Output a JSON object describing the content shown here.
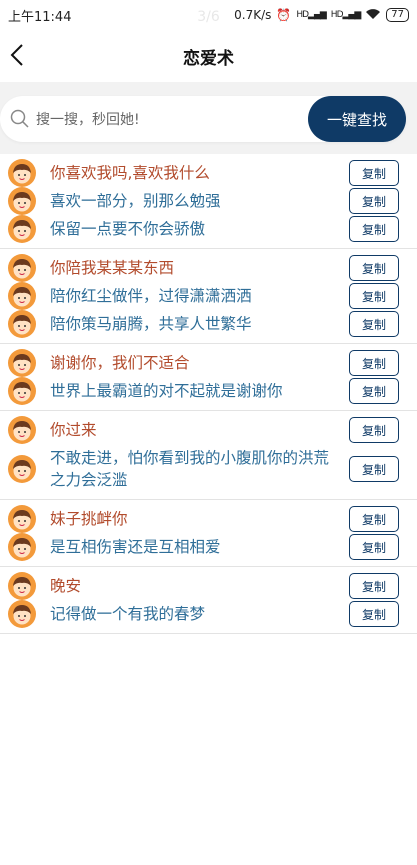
{
  "status_bar": {
    "time": "上午11:44",
    "network_speed": "0.7K/s",
    "signal_1": "HD",
    "signal_2": "HD",
    "battery": "77",
    "page_indicator": "3/6"
  },
  "nav": {
    "title": "恋爱术"
  },
  "search": {
    "placeholder": "搜一搜，秒回她!",
    "button_label": "一键查找"
  },
  "copy_label": "复制",
  "groups": [
    {
      "lines": [
        {
          "role": "lead",
          "text": "你喜欢我吗,喜欢我什么"
        },
        {
          "role": "reply",
          "text": "喜欢一部分，别那么勉强"
        },
        {
          "role": "reply",
          "text": "保留一点要不你会骄傲"
        }
      ]
    },
    {
      "lines": [
        {
          "role": "lead",
          "text": "你陪我某某某东西"
        },
        {
          "role": "reply",
          "text": "陪你红尘做伴，过得潇潇洒洒"
        },
        {
          "role": "reply",
          "text": "陪你策马崩腾，共享人世繁华"
        }
      ]
    },
    {
      "lines": [
        {
          "role": "lead",
          "text": "谢谢你，我们不适合"
        },
        {
          "role": "reply",
          "text": "世界上最霸道的对不起就是谢谢你"
        }
      ]
    },
    {
      "lines": [
        {
          "role": "lead",
          "text": "你过来"
        },
        {
          "role": "reply",
          "text": "不敢走进，怕你看到我的小腹肌你的洪荒之力会泛滥"
        }
      ]
    },
    {
      "lines": [
        {
          "role": "lead",
          "text": "妹子挑衅你"
        },
        {
          "role": "reply",
          "text": "是互相伤害还是互相相爱"
        }
      ]
    },
    {
      "lines": [
        {
          "role": "lead",
          "text": "晚安"
        },
        {
          "role": "reply",
          "text": "记得做一个有我的春梦"
        }
      ]
    }
  ]
}
